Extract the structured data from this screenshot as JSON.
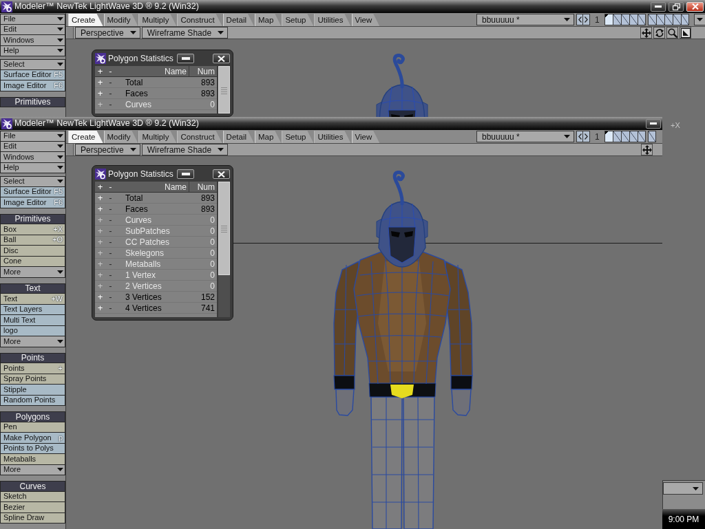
{
  "windows": [
    {
      "title": "Modeler™ NewTek LightWave 3D ® 9.2 (Win32)",
      "title_buttons": [
        {
          "kind": "minimize"
        },
        {
          "kind": "restore"
        },
        {
          "kind": "close"
        }
      ],
      "sidebar": [
        {
          "items": [
            {
              "kind": "dropdown",
              "label": "File"
            },
            {
              "kind": "dropdown",
              "label": "Edit"
            },
            {
              "kind": "dropdown",
              "label": "Windows"
            },
            {
              "kind": "dropdown",
              "label": "Help"
            }
          ]
        },
        {
          "items": [
            {
              "kind": "dropdown",
              "label": "Select"
            },
            {
              "kind": "plugin",
              "label": "Surface Editor",
              "shortcut": "F5"
            },
            {
              "kind": "plugin",
              "label": "Image Editor",
              "shortcut": "F6"
            }
          ]
        },
        {
          "header": "Primitives"
        }
      ],
      "tabs": [
        {
          "label": "Create",
          "selected": true
        },
        {
          "label": "Modify",
          "selected": false
        },
        {
          "label": "Multiply",
          "selected": false
        },
        {
          "label": "Construct",
          "selected": false
        },
        {
          "label": "Detail",
          "selected": false
        },
        {
          "label": "Map",
          "selected": false
        },
        {
          "label": "Setup",
          "selected": false
        },
        {
          "label": "Utilities",
          "selected": false
        },
        {
          "label": "View",
          "selected": false
        }
      ],
      "object_menu": "bbuuuuu *",
      "layer_number": "1",
      "layers": [
        {
          "selected": true
        },
        {
          "selected": false
        },
        {
          "selected": false
        },
        {
          "selected": false
        },
        {
          "selected": false
        },
        {
          "selected": false
        },
        {
          "selected": false
        },
        {
          "selected": false
        },
        {
          "selected": false
        },
        {
          "selected": false
        }
      ],
      "layer_menu": true,
      "view_menu": "Perspective",
      "shading_menu": "Wireframe Shade",
      "view_tools": [
        {
          "kind": "move"
        },
        {
          "kind": "rotate"
        },
        {
          "kind": "zoom"
        },
        {
          "kind": "fit"
        }
      ],
      "stats_panel": {
        "title": "Polygon Statistics",
        "columns": [
          "+",
          "-",
          "Name",
          "Num"
        ],
        "rows": [
          {
            "plus": "+",
            "minus": "-",
            "name": "Total",
            "num": "893",
            "disabled": false
          },
          {
            "plus": "+",
            "minus": "-",
            "name": "Faces",
            "num": "893",
            "disabled": false
          },
          {
            "plus": "+",
            "minus": "-",
            "name": "Curves",
            "num": "0",
            "disabled": true
          }
        ]
      },
      "viewport_label": "+X",
      "bottom_dropdown": true
    },
    {
      "title": "Modeler™ NewTek LightWave 3D ® 9.2 (Win32)",
      "title_buttons": [
        {
          "kind": "minimize"
        }
      ],
      "sidebar": [
        {
          "items": [
            {
              "kind": "dropdown",
              "label": "File"
            },
            {
              "kind": "dropdown",
              "label": "Edit"
            },
            {
              "kind": "dropdown",
              "label": "Windows"
            },
            {
              "kind": "dropdown",
              "label": "Help"
            }
          ]
        },
        {
          "items": [
            {
              "kind": "dropdown",
              "label": "Select"
            },
            {
              "kind": "plugin",
              "label": "Surface Editor",
              "shortcut": "F5"
            },
            {
              "kind": "plugin",
              "label": "Image Editor",
              "shortcut": "F6"
            }
          ]
        },
        {
          "header": "Primitives",
          "items": [
            {
              "kind": "tool",
              "label": "Box",
              "shortcut": "+X"
            },
            {
              "kind": "tool",
              "label": "Ball",
              "shortcut": "+O"
            },
            {
              "kind": "tool",
              "label": "Disc"
            },
            {
              "kind": "tool",
              "label": "Cone"
            },
            {
              "kind": "dropdown",
              "label": "More"
            }
          ]
        },
        {
          "header": "Text",
          "items": [
            {
              "kind": "tool",
              "label": "Text",
              "shortcut": "+W"
            },
            {
              "kind": "plugin",
              "label": "Text Layers"
            },
            {
              "kind": "plugin",
              "label": "Multi Text"
            },
            {
              "kind": "plugin",
              "label": "logo"
            },
            {
              "kind": "dropdown",
              "label": "More"
            }
          ]
        },
        {
          "header": "Points",
          "items": [
            {
              "kind": "tool",
              "label": "Points",
              "shortcut": "+"
            },
            {
              "kind": "tool",
              "label": "Spray Points"
            },
            {
              "kind": "plugin",
              "label": "Stipple"
            },
            {
              "kind": "plugin",
              "label": "Random Points"
            }
          ]
        },
        {
          "header": "Polygons",
          "items": [
            {
              "kind": "tool",
              "label": "Pen"
            },
            {
              "kind": "plugin",
              "label": "Make Polygon",
              "shortcut": "p"
            },
            {
              "kind": "plugin",
              "label": "Points to Polys"
            },
            {
              "kind": "tool",
              "label": "Metaballs"
            },
            {
              "kind": "dropdown",
              "label": "More"
            }
          ]
        },
        {
          "header": "Curves",
          "items": [
            {
              "kind": "tool",
              "label": "Sketch"
            },
            {
              "kind": "tool",
              "label": "Bezier"
            },
            {
              "kind": "tool",
              "label": "Spline Draw"
            }
          ]
        }
      ],
      "tabs": [
        {
          "label": "Create",
          "selected": true
        },
        {
          "label": "Modify",
          "selected": false
        },
        {
          "label": "Multiply",
          "selected": false
        },
        {
          "label": "Construct",
          "selected": false
        },
        {
          "label": "Detail",
          "selected": false
        },
        {
          "label": "Map",
          "selected": false
        },
        {
          "label": "Setup",
          "selected": false
        },
        {
          "label": "Utilities",
          "selected": false
        },
        {
          "label": "View",
          "selected": false
        }
      ],
      "object_menu": "bbuuuuu *",
      "layer_number": "1",
      "layers": [
        {
          "selected": true
        },
        {
          "selected": false
        },
        {
          "selected": false
        },
        {
          "selected": false
        },
        {
          "selected": false
        },
        {
          "selected": false
        }
      ],
      "view_menu": "Perspective",
      "shading_menu": "Wireframe Shade",
      "view_tools": [
        {
          "kind": "move"
        }
      ],
      "stats_panel": {
        "title": "Polygon Statistics",
        "columns": [
          "+",
          "-",
          "Name",
          "Num"
        ],
        "rows": [
          {
            "plus": "+",
            "minus": "-",
            "name": "Total",
            "num": "893",
            "disabled": false
          },
          {
            "plus": "+",
            "minus": "-",
            "name": "Faces",
            "num": "893",
            "disabled": false
          },
          {
            "plus": "+",
            "minus": "-",
            "name": "Curves",
            "num": "0",
            "disabled": true
          },
          {
            "plus": "+",
            "minus": "-",
            "name": "SubPatches",
            "num": "0",
            "disabled": true
          },
          {
            "plus": "+",
            "minus": "-",
            "name": "CC Patches",
            "num": "0",
            "disabled": true
          },
          {
            "plus": "+",
            "minus": "-",
            "name": "Skelegons",
            "num": "0",
            "disabled": true
          },
          {
            "plus": "+",
            "minus": "-",
            "name": "Metaballs",
            "num": "0",
            "disabled": true
          },
          {
            "plus": "+",
            "minus": "-",
            "name": "1 Vertex",
            "num": "0",
            "disabled": true
          },
          {
            "plus": "+",
            "minus": "-",
            "name": "2 Vertices",
            "num": "0",
            "disabled": true
          },
          {
            "plus": "+",
            "minus": "-",
            "name": "3 Vertices",
            "num": "152",
            "disabled": false
          },
          {
            "plus": "+",
            "minus": "-",
            "name": "4 Vertices",
            "num": "741",
            "disabled": false
          }
        ]
      }
    }
  ],
  "taskbar": {
    "clock": "9:00 PM"
  }
}
